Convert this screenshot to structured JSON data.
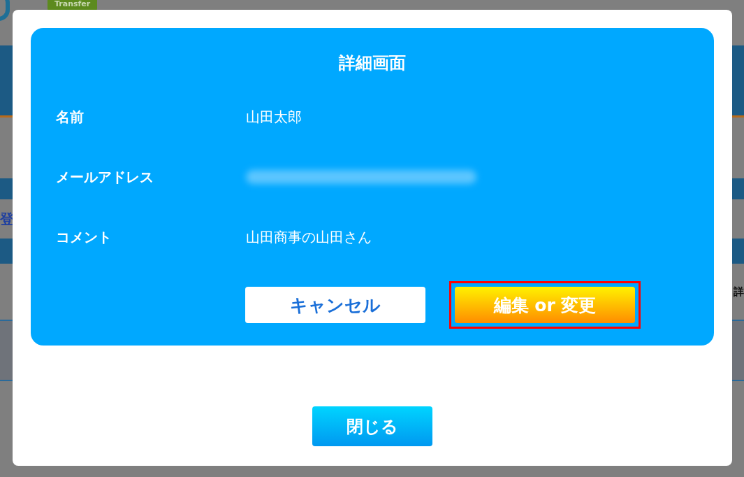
{
  "background": {
    "badge": "Transfer",
    "left_text": "登",
    "right_text": "詳"
  },
  "dialog": {
    "title": "詳細画面",
    "fields": [
      {
        "label": "名前",
        "value": "山田太郎",
        "redacted": false
      },
      {
        "label": "メールアドレス",
        "redacted": true
      },
      {
        "label": "コメント",
        "value": "山田商事の山田さん",
        "redacted": false
      }
    ],
    "buttons": [
      {
        "label": "キャンセル",
        "kind": "secondary",
        "highlighted": false
      },
      {
        "label": "編集 or 変更",
        "kind": "primary",
        "highlighted": true
      }
    ],
    "close_button": "閉じる"
  }
}
